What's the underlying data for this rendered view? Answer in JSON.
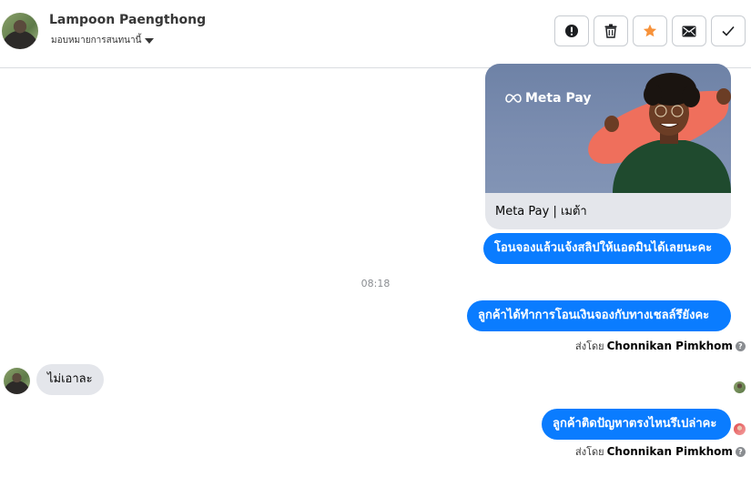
{
  "header": {
    "contact_name": "Lampoon Paengthong",
    "assign_label": "มอบหมายการสนทนานี้",
    "actions": [
      {
        "name": "spam",
        "icon": "exclamation-icon"
      },
      {
        "name": "delete",
        "icon": "trash-icon"
      },
      {
        "name": "star",
        "icon": "star-icon",
        "color": "#f7923a"
      },
      {
        "name": "mail",
        "icon": "envelope-icon"
      },
      {
        "name": "done",
        "icon": "check-icon"
      }
    ]
  },
  "card": {
    "brand": "Meta Pay",
    "caption": "Meta Pay | เมต้า"
  },
  "messages": {
    "m1": "โอนจองแล้วแจ้งสลิปให้แอดมินได้เลยนะคะ",
    "timestamp": "08:18",
    "m2": "ลูกค้าได้ทำการโอนเงินจองกับทางเชลล์รึยังคะ",
    "m2_sent_by_prefix": "ส่งโดย",
    "m2_sender": "Chonnikan Pimkhom",
    "m3": "ไม่เอาละ",
    "m4": "ลูกค้าติดปัญหาตรงไหนรึเปล่าคะ",
    "m4_sent_by_prefix": "ส่งโดย",
    "m4_sender": "Chonnikan Pimkhom"
  },
  "colors": {
    "outgoing_bubble": "#0a7cff",
    "incoming_bubble": "#e4e6eb",
    "accent_star": "#f7923a"
  }
}
